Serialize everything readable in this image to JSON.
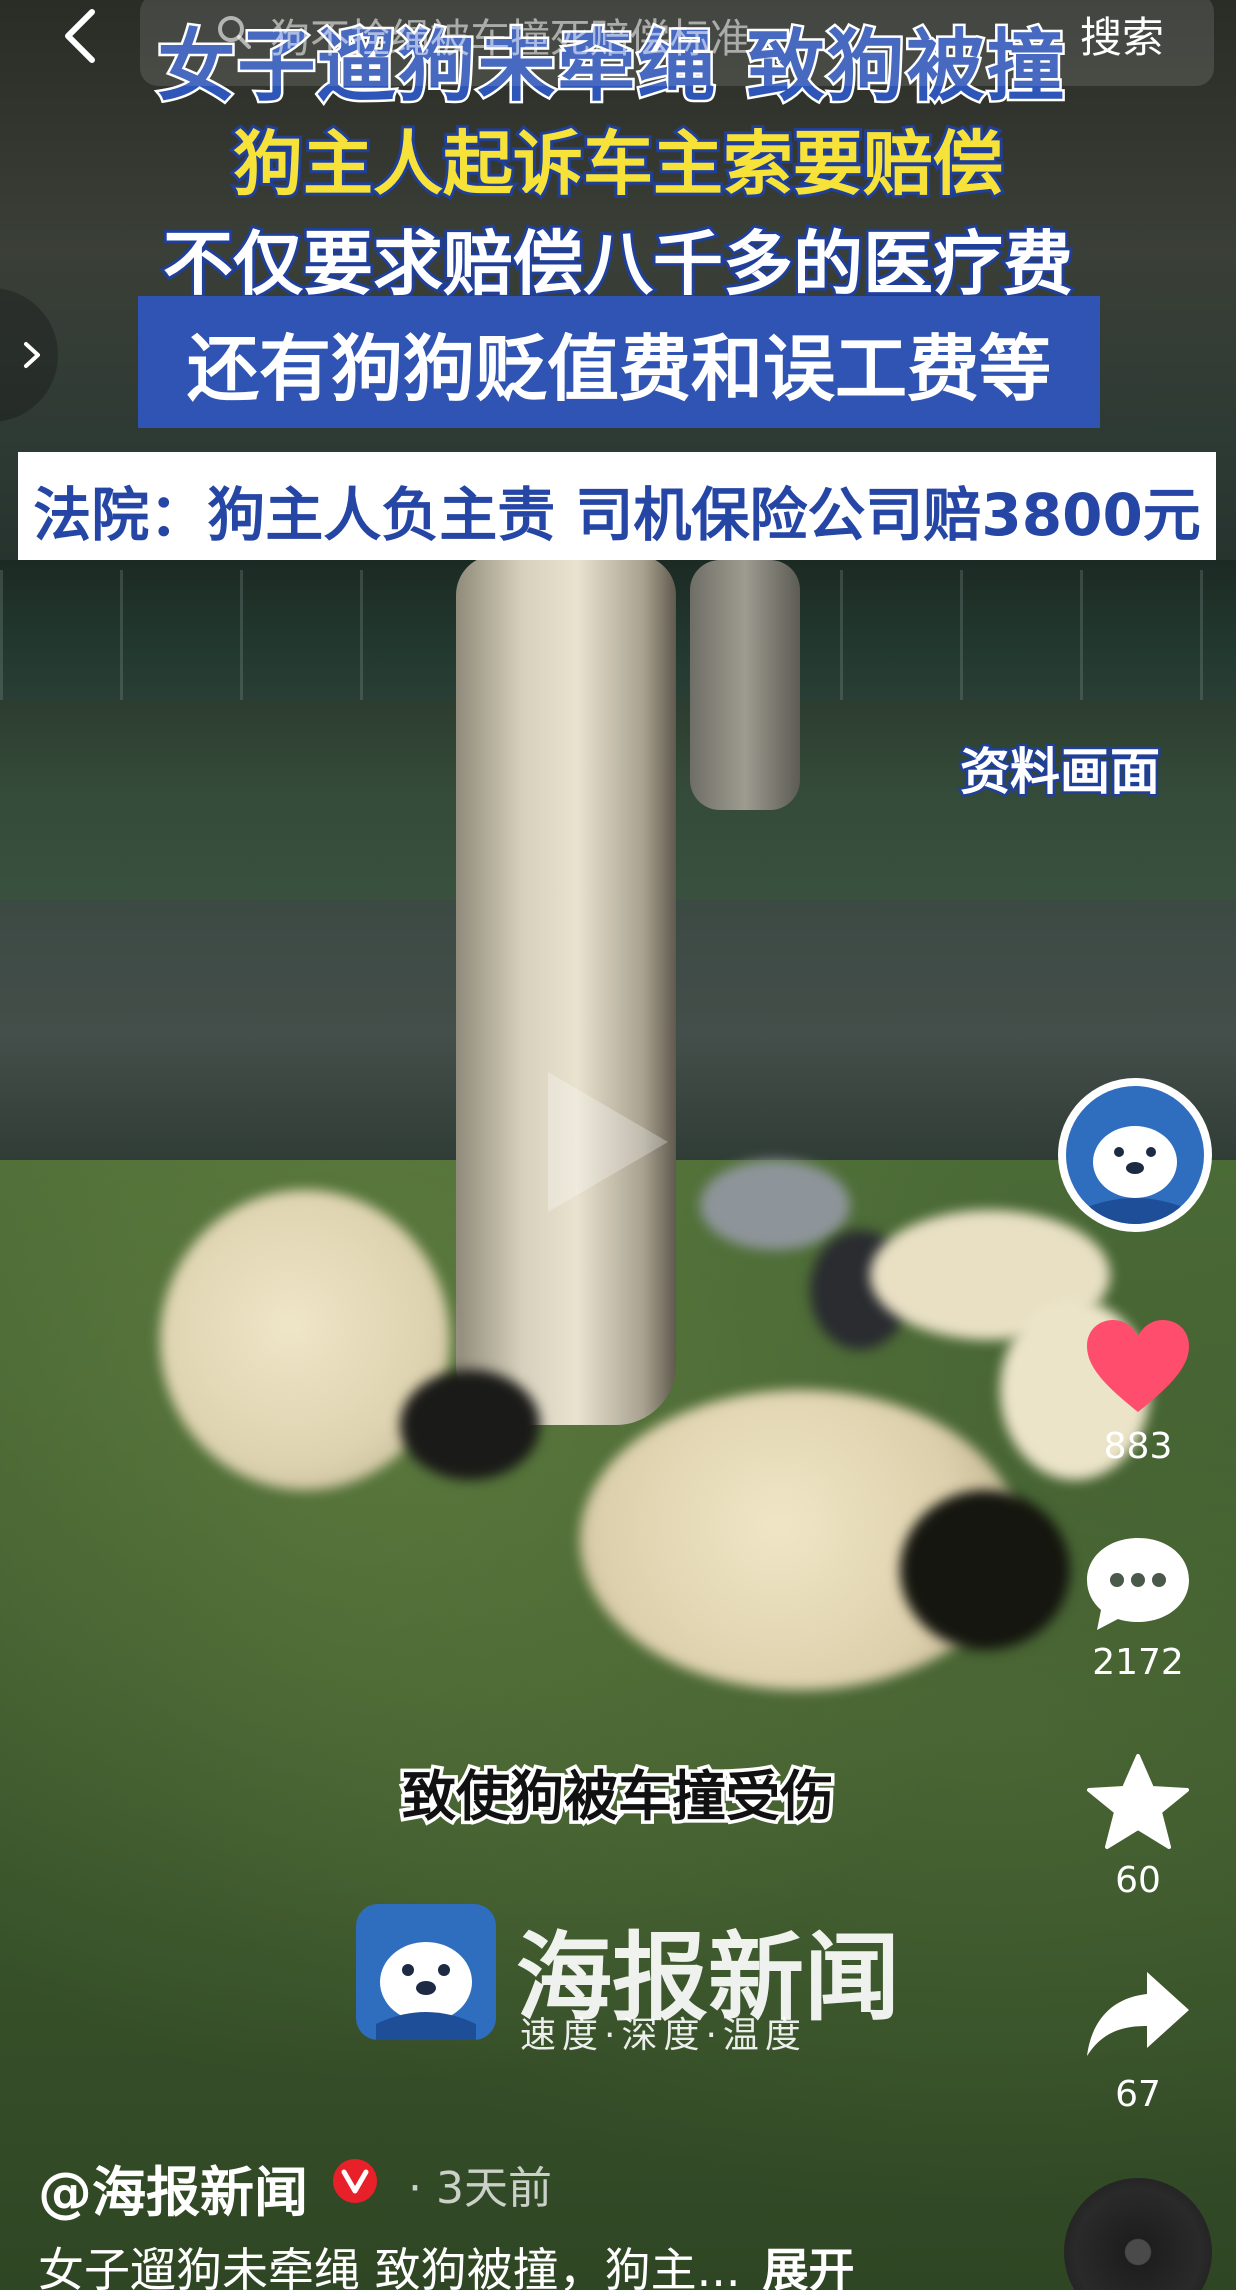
{
  "search": {
    "query": "狗不拴绳被车撞死赔偿标准",
    "button_label": "搜索"
  },
  "video": {
    "headline_1": "女子遛狗未牵绳 致狗被撞",
    "headline_2": "狗主人起诉车主索要赔偿",
    "headline_3": "不仅要求赔偿八千多的医疗费",
    "headline_4": "还有狗狗贬值费和误工费等",
    "court_banner": "法院：狗主人负主责 司机保险公司赔3800元",
    "archive_tag": "资料画面",
    "subtitle": "致使狗被车撞受伤",
    "brand_name": "海报新闻",
    "brand_slogan": "速度·深度·温度"
  },
  "actions": {
    "likes": "883",
    "comments": "2172",
    "favorites": "60",
    "shares": "67"
  },
  "post": {
    "author": "@海报新闻",
    "time": "3天前",
    "description": "女子遛狗未牵绳 致狗被撞，狗主...",
    "expand_label": "展开"
  },
  "colors": {
    "like": "#ff4d6d",
    "caption_blue": "#2f54b3",
    "caption_yellow": "#f7e23a"
  }
}
